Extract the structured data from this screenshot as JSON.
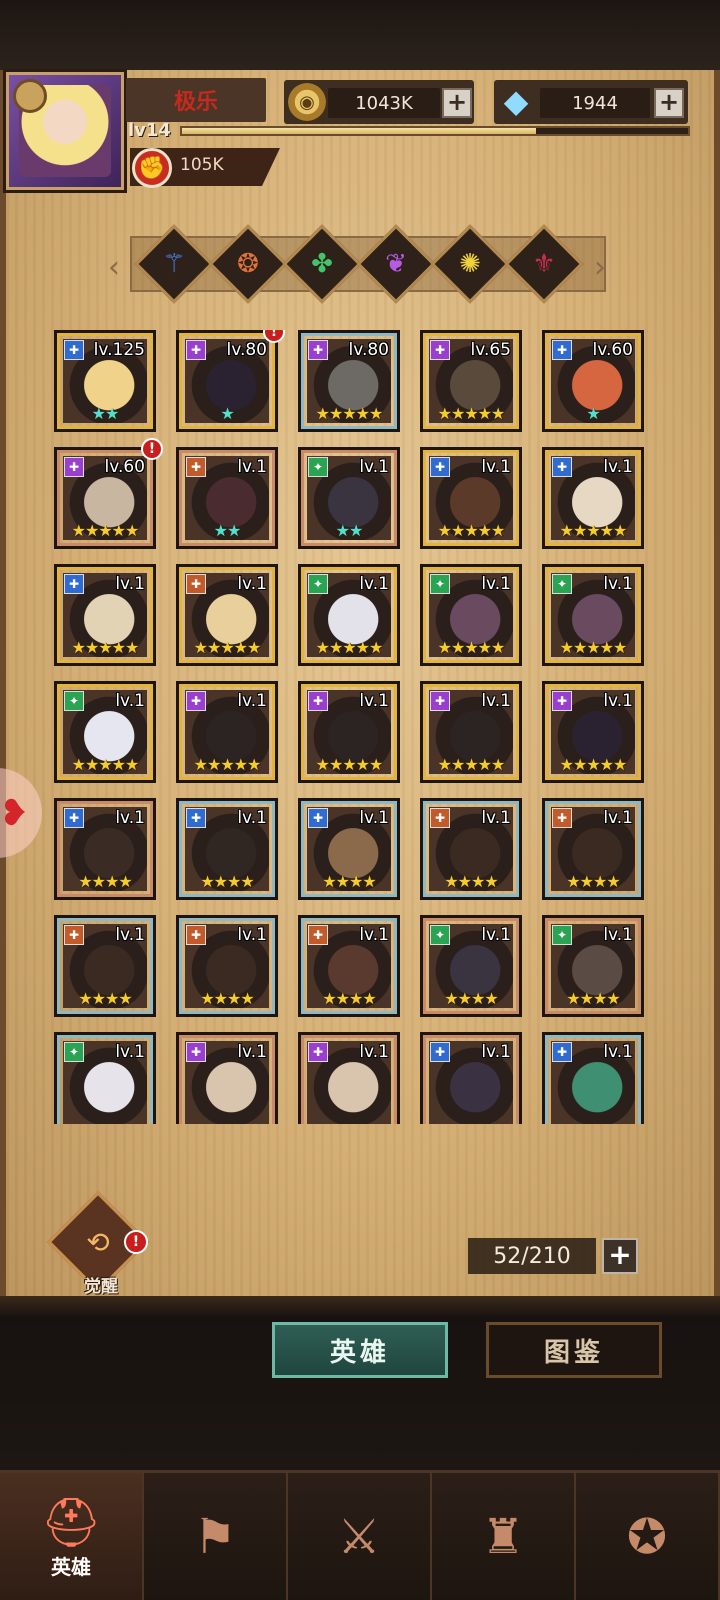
{
  "player": {
    "name": "极乐",
    "level_label": "lv14",
    "xp_fraction": 0.7,
    "power": "105K"
  },
  "resources": {
    "gold": "1043K",
    "diamonds": "1944",
    "plus": "+"
  },
  "element_filters": [
    "water",
    "fire",
    "nature",
    "light-purple",
    "holy",
    "dark"
  ],
  "colors": {
    "water": "#2f6bd1",
    "fire": "#c35a2a",
    "nature": "#2aa352",
    "arcane": "#9a3ed0",
    "holy": "#d8b626",
    "dark": "#8a1f3a"
  },
  "heroes": [
    {
      "level": "lv.125",
      "element": "water",
      "rarity": "r5",
      "stars": "★★",
      "star_color": "teal",
      "alert": false,
      "skin": "#f1d28b"
    },
    {
      "level": "lv.80",
      "element": "arcane",
      "rarity": "r5",
      "stars": "★",
      "star_color": "teal",
      "alert": true,
      "skin": "#2a2230"
    },
    {
      "level": "lv.80",
      "element": "arcane",
      "rarity": "r4",
      "stars": "★★★★★",
      "star_color": "gold",
      "alert": false,
      "skin": "#6d6a66"
    },
    {
      "level": "lv.65",
      "element": "arcane",
      "rarity": "r5",
      "stars": "★★★★★",
      "star_color": "gold",
      "alert": false,
      "skin": "#5a4a3c"
    },
    {
      "level": "lv.60",
      "element": "water",
      "rarity": "r5",
      "stars": "★",
      "star_color": "teal",
      "alert": false,
      "skin": "#d5663f"
    },
    {
      "level": "lv.60",
      "element": "arcane",
      "rarity": "r3",
      "stars": "★★★★★",
      "star_color": "gold",
      "alert": true,
      "skin": "#c9b6a0"
    },
    {
      "level": "lv.1",
      "element": "fire",
      "rarity": "r3",
      "stars": "★★",
      "star_color": "teal",
      "alert": false,
      "skin": "#4a2c30"
    },
    {
      "level": "lv.1",
      "element": "nature",
      "rarity": "r3",
      "stars": "★★",
      "star_color": "teal",
      "alert": false,
      "skin": "#3a3340"
    },
    {
      "level": "lv.1",
      "element": "water",
      "rarity": "r5",
      "stars": "★★★★★",
      "star_color": "gold",
      "alert": false,
      "skin": "#5b3a2a"
    },
    {
      "level": "lv.1",
      "element": "water",
      "rarity": "r5",
      "stars": "★★★★★",
      "star_color": "gold",
      "alert": false,
      "skin": "#e6d8c2"
    },
    {
      "level": "lv.1",
      "element": "water",
      "rarity": "r5",
      "stars": "★★★★★",
      "star_color": "gold",
      "alert": false,
      "skin": "#e3d3b5"
    },
    {
      "level": "lv.1",
      "element": "fire",
      "rarity": "r5",
      "stars": "★★★★★",
      "star_color": "gold",
      "alert": false,
      "skin": "#e8cf9c"
    },
    {
      "level": "lv.1",
      "element": "nature",
      "rarity": "r5",
      "stars": "★★★★★",
      "star_color": "gold",
      "alert": false,
      "skin": "#e3e1ea"
    },
    {
      "level": "lv.1",
      "element": "nature",
      "rarity": "r5",
      "stars": "★★★★★",
      "star_color": "gold",
      "alert": false,
      "skin": "#6a4a5e"
    },
    {
      "level": "lv.1",
      "element": "nature",
      "rarity": "r5",
      "stars": "★★★★★",
      "star_color": "gold",
      "alert": false,
      "skin": "#6a4a5e"
    },
    {
      "level": "lv.1",
      "element": "nature",
      "rarity": "r5",
      "stars": "★★★★★",
      "star_color": "gold",
      "alert": false,
      "skin": "#e5e6ef"
    },
    {
      "level": "lv.1",
      "element": "arcane",
      "rarity": "r5",
      "stars": "★★★★★",
      "star_color": "gold",
      "alert": false,
      "skin": "#2c2422"
    },
    {
      "level": "lv.1",
      "element": "arcane",
      "rarity": "r5",
      "stars": "★★★★★",
      "star_color": "gold",
      "alert": false,
      "skin": "#2c2422"
    },
    {
      "level": "lv.1",
      "element": "arcane",
      "rarity": "r5",
      "stars": "★★★★★",
      "star_color": "gold",
      "alert": false,
      "skin": "#2c2422"
    },
    {
      "level": "lv.1",
      "element": "arcane",
      "rarity": "r5",
      "stars": "★★★★★",
      "star_color": "gold",
      "alert": false,
      "skin": "#2a2230"
    },
    {
      "level": "lv.1",
      "element": "water",
      "rarity": "r3",
      "stars": "★★★★",
      "star_color": "gold",
      "alert": false,
      "skin": "#3a2c24"
    },
    {
      "level": "lv.1",
      "element": "water",
      "rarity": "r4",
      "stars": "★★★★",
      "star_color": "gold",
      "alert": false,
      "skin": "#302622"
    },
    {
      "level": "lv.1",
      "element": "water",
      "rarity": "r4",
      "stars": "★★★★",
      "star_color": "gold",
      "alert": false,
      "skin": "#8a6a4a"
    },
    {
      "level": "lv.1",
      "element": "fire",
      "rarity": "r4",
      "stars": "★★★★",
      "star_color": "gold",
      "alert": false,
      "skin": "#3a2a22"
    },
    {
      "level": "lv.1",
      "element": "fire",
      "rarity": "r4",
      "stars": "★★★★",
      "star_color": "gold",
      "alert": false,
      "skin": "#3a2a22"
    },
    {
      "level": "lv.1",
      "element": "fire",
      "rarity": "r4",
      "stars": "★★★★",
      "star_color": "gold",
      "alert": false,
      "skin": "#3a2a22"
    },
    {
      "level": "lv.1",
      "element": "fire",
      "rarity": "r4",
      "stars": "★★★★",
      "star_color": "gold",
      "alert": false,
      "skin": "#3a2a22"
    },
    {
      "level": "lv.1",
      "element": "fire",
      "rarity": "r4",
      "stars": "★★★★",
      "star_color": "gold",
      "alert": false,
      "skin": "#5a3a2e"
    },
    {
      "level": "lv.1",
      "element": "nature",
      "rarity": "r3",
      "stars": "★★★★",
      "star_color": "gold",
      "alert": false,
      "skin": "#3a3340"
    },
    {
      "level": "lv.1",
      "element": "nature",
      "rarity": "r3",
      "stars": "★★★★",
      "star_color": "gold",
      "alert": false,
      "skin": "#5a4c44"
    },
    {
      "level": "lv.1",
      "element": "nature",
      "rarity": "r4",
      "stars": "",
      "star_color": "gold",
      "alert": false,
      "skin": "#e6e4ea"
    },
    {
      "level": "lv.1",
      "element": "arcane",
      "rarity": "r3",
      "stars": "",
      "star_color": "gold",
      "alert": false,
      "skin": "#d9c5ad"
    },
    {
      "level": "lv.1",
      "element": "arcane",
      "rarity": "r3",
      "stars": "",
      "star_color": "gold",
      "alert": false,
      "skin": "#d9c5ad"
    },
    {
      "level": "lv.1",
      "element": "water",
      "rarity": "r3",
      "stars": "",
      "star_color": "gold",
      "alert": false,
      "skin": "#3a3142"
    },
    {
      "level": "lv.1",
      "element": "water",
      "rarity": "r4",
      "stars": "",
      "star_color": "gold",
      "alert": false,
      "skin": "#3f8f73"
    }
  ],
  "awaken": {
    "label": "觉醒",
    "alert": "!"
  },
  "capacity": {
    "text": "52/210",
    "plus": "+"
  },
  "segment_tabs": {
    "heroes": "英雄",
    "codex": "图鉴"
  },
  "bottom_nav": [
    {
      "name": "heroes",
      "label": "英雄",
      "icon": "helmet-icon",
      "active": true
    },
    {
      "name": "adventure",
      "label": "",
      "icon": "flag-icon",
      "active": false
    },
    {
      "name": "battle",
      "label": "",
      "icon": "crossed-swords-icon",
      "active": false
    },
    {
      "name": "castle",
      "label": "",
      "icon": "tower-icon",
      "active": false
    },
    {
      "name": "guild",
      "label": "",
      "icon": "handshake-icon",
      "active": false
    }
  ]
}
